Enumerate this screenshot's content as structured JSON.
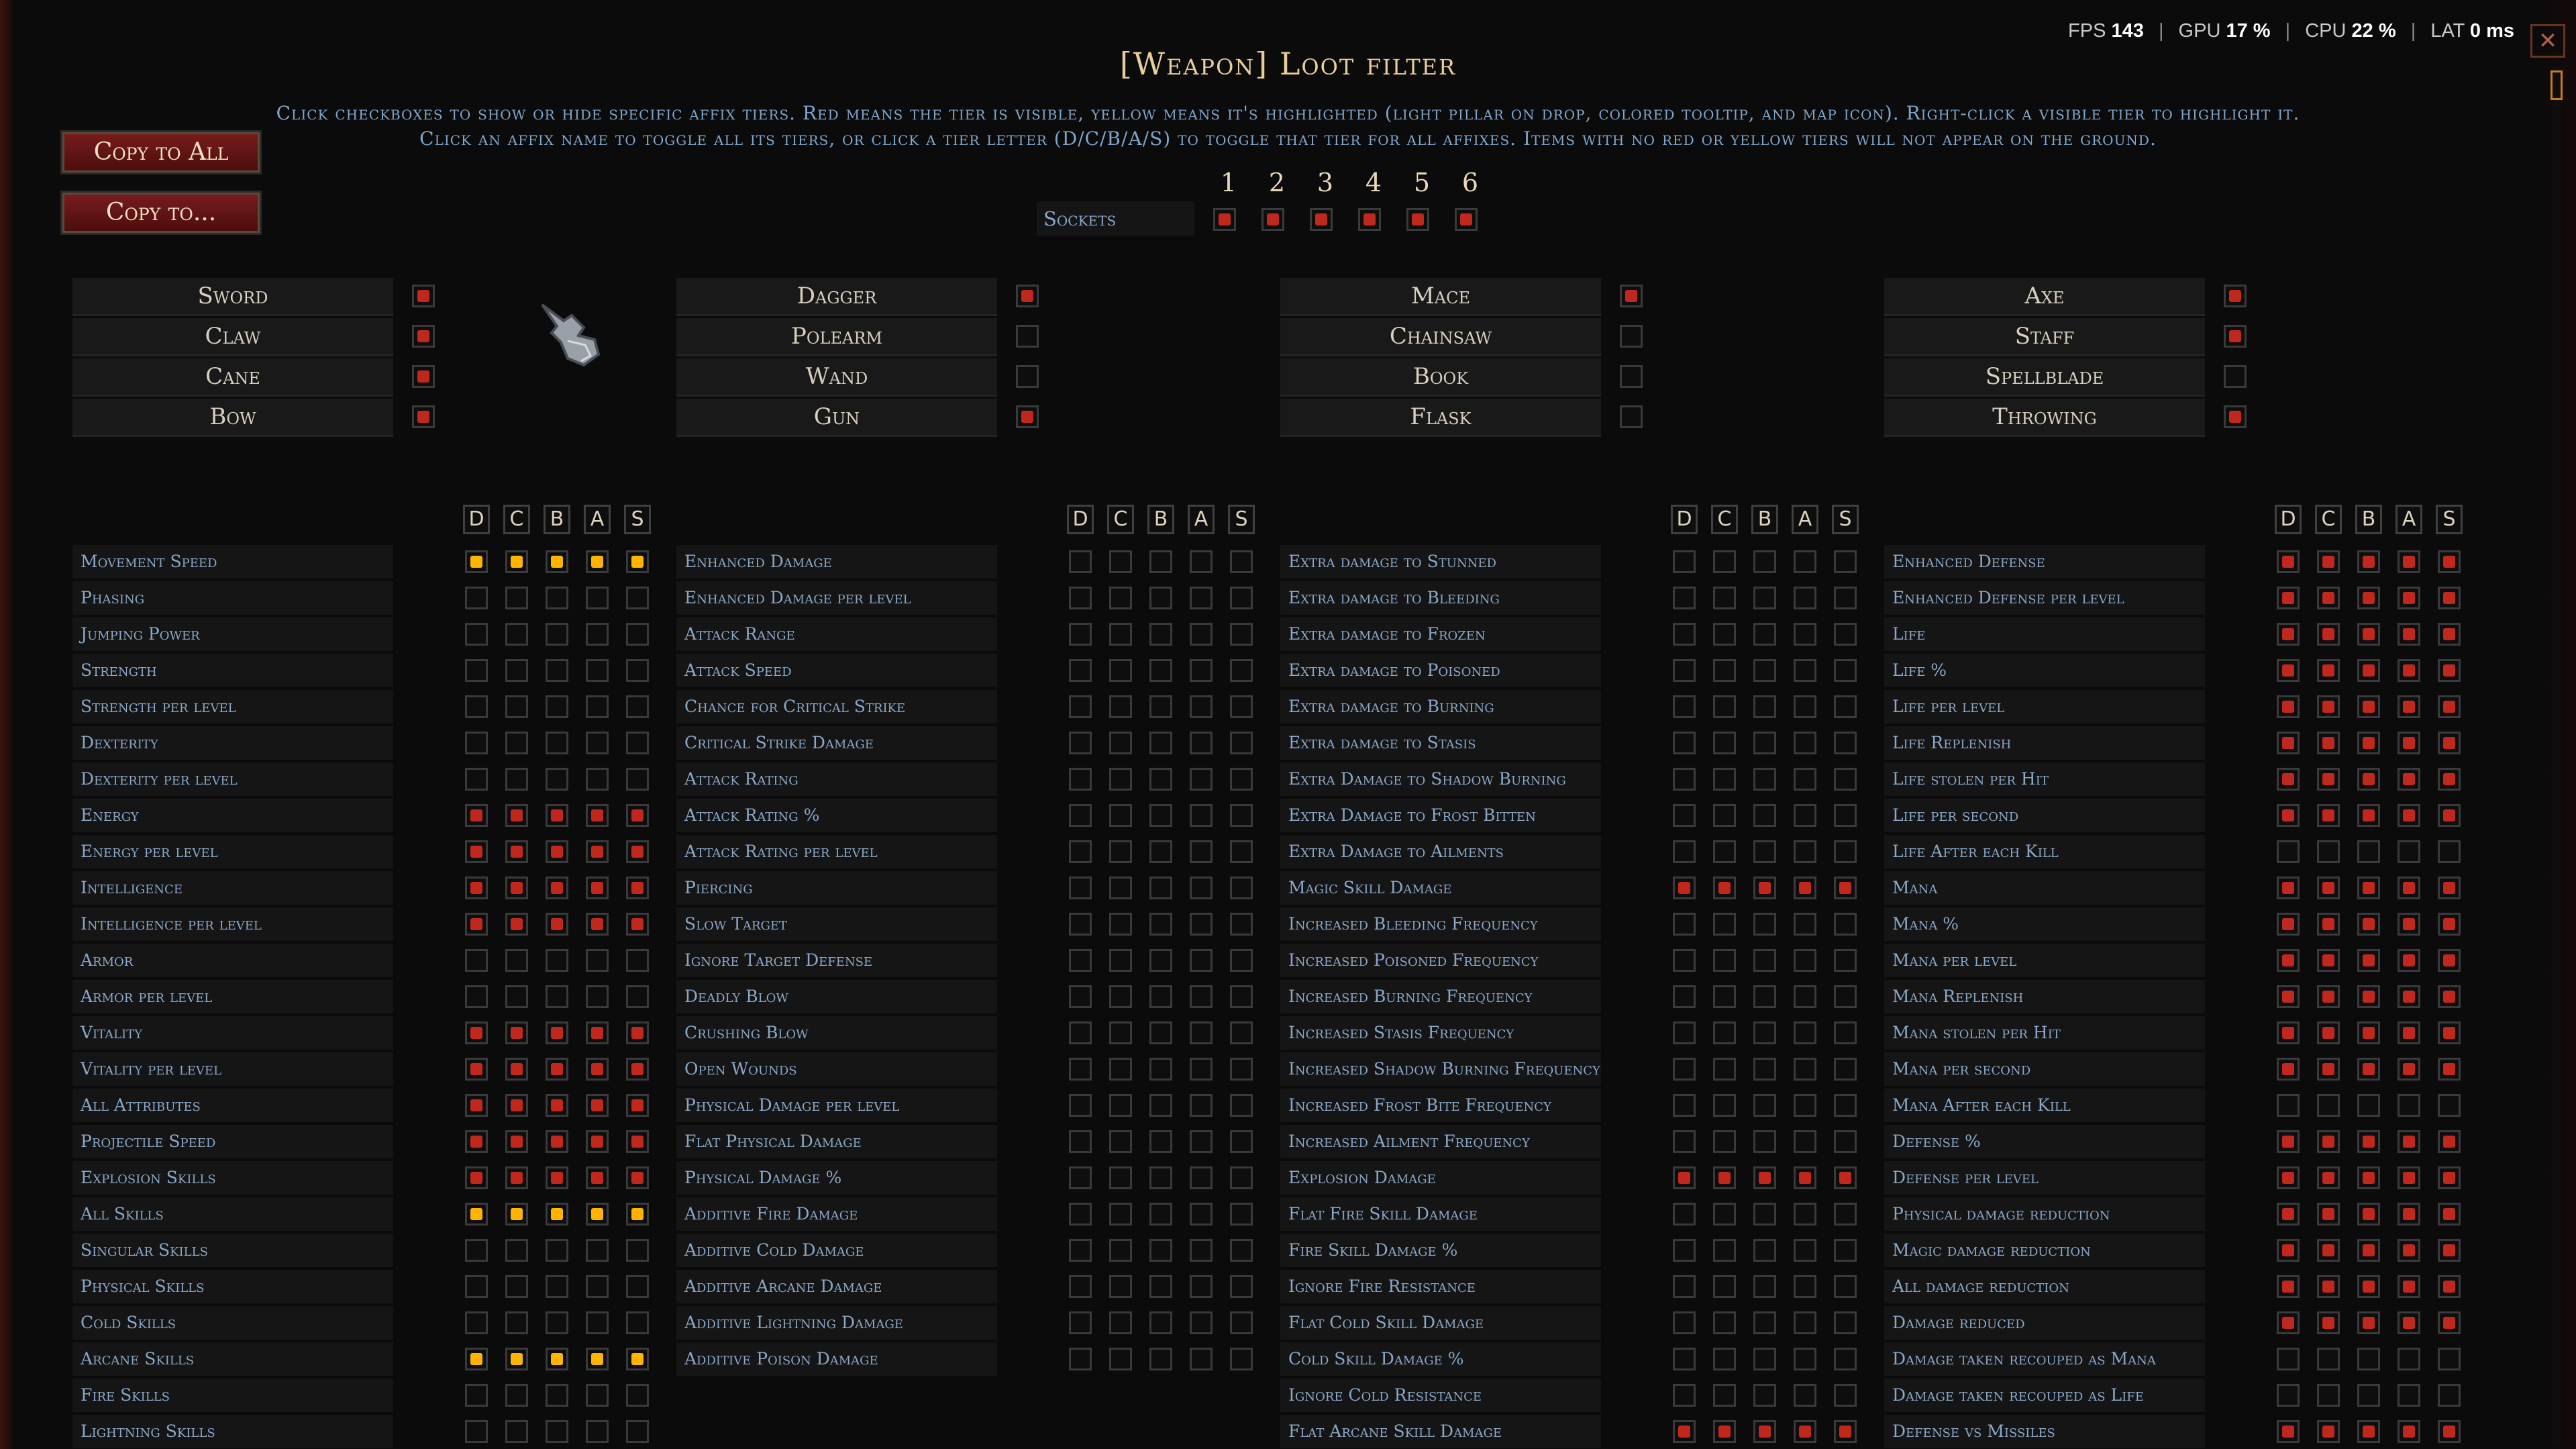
{
  "perf": {
    "fps_label": "FPS",
    "fps": "143",
    "gpu_label": "GPU",
    "gpu": "17 %",
    "cpu_label": "CPU",
    "cpu": "22 %",
    "lat_label": "LAT",
    "lat": "0 ms"
  },
  "title": "[Weapon] Loot filter",
  "instructions": [
    "Click checkboxes to show or hide specific affix tiers. Red means the tier is visible, yellow means it's highlighted (light pillar on drop, colored tooltip, and map icon). Right-click a visible tier to highlight it.",
    "Click an affix name to toggle all its tiers, or click a tier letter (D/C/B/A/S) to toggle that tier for all affixes. Items with no red or yellow tiers will not appear on the ground."
  ],
  "buttons": {
    "copy_all": "Copy to All",
    "copy_to": "Copy to..."
  },
  "sockets": {
    "label": "Sockets",
    "numbers": [
      "1",
      "2",
      "3",
      "4",
      "5",
      "6"
    ],
    "states": [
      "red",
      "red",
      "red",
      "red",
      "red",
      "red"
    ]
  },
  "weapon_columns": [
    [
      {
        "name": "Sword",
        "state": "red"
      },
      {
        "name": "Claw",
        "state": "red"
      },
      {
        "name": "Cane",
        "state": "red"
      },
      {
        "name": "Bow",
        "state": "red"
      }
    ],
    [
      {
        "name": "Dagger",
        "state": "red"
      },
      {
        "name": "Polearm",
        "state": "empty"
      },
      {
        "name": "Wand",
        "state": "empty"
      },
      {
        "name": "Gun",
        "state": "red"
      }
    ],
    [
      {
        "name": "Mace",
        "state": "red"
      },
      {
        "name": "Chainsaw",
        "state": "empty"
      },
      {
        "name": "Book",
        "state": "empty"
      },
      {
        "name": "Flask",
        "state": "empty"
      }
    ],
    [
      {
        "name": "Axe",
        "state": "red"
      },
      {
        "name": "Staff",
        "state": "red"
      },
      {
        "name": "Spellblade",
        "state": "empty"
      },
      {
        "name": "Throwing",
        "state": "red"
      }
    ]
  ],
  "tier_letters": [
    "D",
    "C",
    "B",
    "A",
    "S"
  ],
  "affix_columns": [
    [
      {
        "name": "Movement Speed",
        "tiers": "YYYYY"
      },
      {
        "name": "Phasing",
        "tiers": "-----"
      },
      {
        "name": "Jumping Power",
        "tiers": "-----"
      },
      {
        "name": "Strength",
        "tiers": "-----"
      },
      {
        "name": "Strength per level",
        "tiers": "-----"
      },
      {
        "name": "Dexterity",
        "tiers": "-----"
      },
      {
        "name": "Dexterity per level",
        "tiers": "-----"
      },
      {
        "name": "Energy",
        "tiers": "RRRRR"
      },
      {
        "name": "Energy per level",
        "tiers": "RRRRR"
      },
      {
        "name": "Intelligence",
        "tiers": "RRRRR"
      },
      {
        "name": "Intelligence per level",
        "tiers": "RRRRR"
      },
      {
        "name": "Armor",
        "tiers": "-----"
      },
      {
        "name": "Armor per level",
        "tiers": "-----"
      },
      {
        "name": "Vitality",
        "tiers": "RRRRR"
      },
      {
        "name": "Vitality per level",
        "tiers": "RRRRR"
      },
      {
        "name": "All Attributes",
        "tiers": "RRRRR"
      },
      {
        "name": "Projectile Speed",
        "tiers": "RRRRR"
      },
      {
        "name": "Explosion Skills",
        "tiers": "RRRRR"
      },
      {
        "name": "All Skills",
        "tiers": "YYYYY"
      },
      {
        "name": "Singular Skills",
        "tiers": "-----"
      },
      {
        "name": "Physical Skills",
        "tiers": "-----"
      },
      {
        "name": "Cold Skills",
        "tiers": "-----"
      },
      {
        "name": "Arcane Skills",
        "tiers": "YYYYY"
      },
      {
        "name": "Fire Skills",
        "tiers": "-----"
      },
      {
        "name": "Lightning Skills",
        "tiers": "-----"
      }
    ],
    [
      {
        "name": "Enhanced Damage",
        "tiers": "-----"
      },
      {
        "name": "Enhanced Damage per level",
        "tiers": "-----"
      },
      {
        "name": "Attack Range",
        "tiers": "-----"
      },
      {
        "name": "Attack Speed",
        "tiers": "-----"
      },
      {
        "name": "Chance for Critical Strike",
        "tiers": "-----"
      },
      {
        "name": "Critical Strike Damage",
        "tiers": "-----"
      },
      {
        "name": "Attack Rating",
        "tiers": "-----"
      },
      {
        "name": "Attack Rating %",
        "tiers": "-----"
      },
      {
        "name": "Attack Rating per level",
        "tiers": "-----"
      },
      {
        "name": "Piercing",
        "tiers": "-----"
      },
      {
        "name": "Slow Target",
        "tiers": "-----"
      },
      {
        "name": "Ignore Target Defense",
        "tiers": "-----"
      },
      {
        "name": "Deadly Blow",
        "tiers": "-----"
      },
      {
        "name": "Crushing Blow",
        "tiers": "-----"
      },
      {
        "name": "Open Wounds",
        "tiers": "-----"
      },
      {
        "name": "Physical Damage per level",
        "tiers": "-----"
      },
      {
        "name": "Flat Physical Damage",
        "tiers": "-----"
      },
      {
        "name": "Physical Damage %",
        "tiers": "-----"
      },
      {
        "name": "Additive Fire Damage",
        "tiers": "-----"
      },
      {
        "name": "Additive Cold Damage",
        "tiers": "-----"
      },
      {
        "name": "Additive Arcane Damage",
        "tiers": "-----"
      },
      {
        "name": "Additive Lightning Damage",
        "tiers": "-----"
      },
      {
        "name": "Additive Poison Damage",
        "tiers": "-----"
      }
    ],
    [
      {
        "name": "Extra damage to Stunned",
        "tiers": "-----"
      },
      {
        "name": "Extra damage to Bleeding",
        "tiers": "-----"
      },
      {
        "name": "Extra damage to Frozen",
        "tiers": "-----"
      },
      {
        "name": "Extra damage to Poisoned",
        "tiers": "-----"
      },
      {
        "name": "Extra damage to Burning",
        "tiers": "-----"
      },
      {
        "name": "Extra damage to Stasis",
        "tiers": "-----"
      },
      {
        "name": "Extra Damage to Shadow Burning",
        "tiers": "-----"
      },
      {
        "name": "Extra Damage to Frost Bitten",
        "tiers": "-----"
      },
      {
        "name": "Extra Damage to Ailments",
        "tiers": "-----"
      },
      {
        "name": "Magic Skill Damage",
        "tiers": "RRRRR"
      },
      {
        "name": "Increased Bleeding Frequency",
        "tiers": "-----"
      },
      {
        "name": "Increased Poisoned Frequency",
        "tiers": "-----"
      },
      {
        "name": "Increased Burning Frequency",
        "tiers": "-----"
      },
      {
        "name": "Increased Stasis Frequency",
        "tiers": "-----"
      },
      {
        "name": "Increased Shadow Burning Frequency",
        "tiers": "-----"
      },
      {
        "name": "Increased Frost Bite Frequency",
        "tiers": "-----"
      },
      {
        "name": "Increased Ailment Frequency",
        "tiers": "-----"
      },
      {
        "name": "Explosion Damage",
        "tiers": "RRRRR"
      },
      {
        "name": "Flat Fire Skill Damage",
        "tiers": "-----"
      },
      {
        "name": "Fire Skill Damage %",
        "tiers": "-----"
      },
      {
        "name": "Ignore Fire Resistance",
        "tiers": "-----"
      },
      {
        "name": "Flat Cold Skill Damage",
        "tiers": "-----"
      },
      {
        "name": "Cold Skill Damage %",
        "tiers": "-----"
      },
      {
        "name": "Ignore Cold Resistance",
        "tiers": "-----"
      },
      {
        "name": "Flat Arcane Skill Damage",
        "tiers": "RRRRR"
      }
    ],
    [
      {
        "name": "Enhanced Defense",
        "tiers": "RRRRR"
      },
      {
        "name": "Enhanced Defense per level",
        "tiers": "RRRRR"
      },
      {
        "name": "Life",
        "tiers": "RRRRR"
      },
      {
        "name": "Life %",
        "tiers": "RRRRR"
      },
      {
        "name": "Life per level",
        "tiers": "RRRRR"
      },
      {
        "name": "Life Replenish",
        "tiers": "RRRRR"
      },
      {
        "name": "Life stolen per Hit",
        "tiers": "RRRRR"
      },
      {
        "name": "Life per second",
        "tiers": "RRRRR"
      },
      {
        "name": "Life After each Kill",
        "tiers": "-----"
      },
      {
        "name": "Mana",
        "tiers": "RRRRR"
      },
      {
        "name": "Mana %",
        "tiers": "RRRRR"
      },
      {
        "name": "Mana per level",
        "tiers": "RRRRR"
      },
      {
        "name": "Mana Replenish",
        "tiers": "RRRRR"
      },
      {
        "name": "Mana stolen per Hit",
        "tiers": "RRRRR"
      },
      {
        "name": "Mana per second",
        "tiers": "RRRRR"
      },
      {
        "name": "Mana After each Kill",
        "tiers": "-----"
      },
      {
        "name": "Defense %",
        "tiers": "RRRRR"
      },
      {
        "name": "Defense per level",
        "tiers": "RRRRR"
      },
      {
        "name": "Physical damage reduction",
        "tiers": "RRRRR"
      },
      {
        "name": "Magic damage reduction",
        "tiers": "RRRRR"
      },
      {
        "name": "All damage reduction",
        "tiers": "RRRRR"
      },
      {
        "name": "Damage reduced",
        "tiers": "RRRRR"
      },
      {
        "name": "Damage taken recouped as Mana",
        "tiers": "-----"
      },
      {
        "name": "Damage taken recouped as Life",
        "tiers": "-----"
      },
      {
        "name": "Defense vs Missiles",
        "tiers": "RRRRR"
      }
    ]
  ]
}
